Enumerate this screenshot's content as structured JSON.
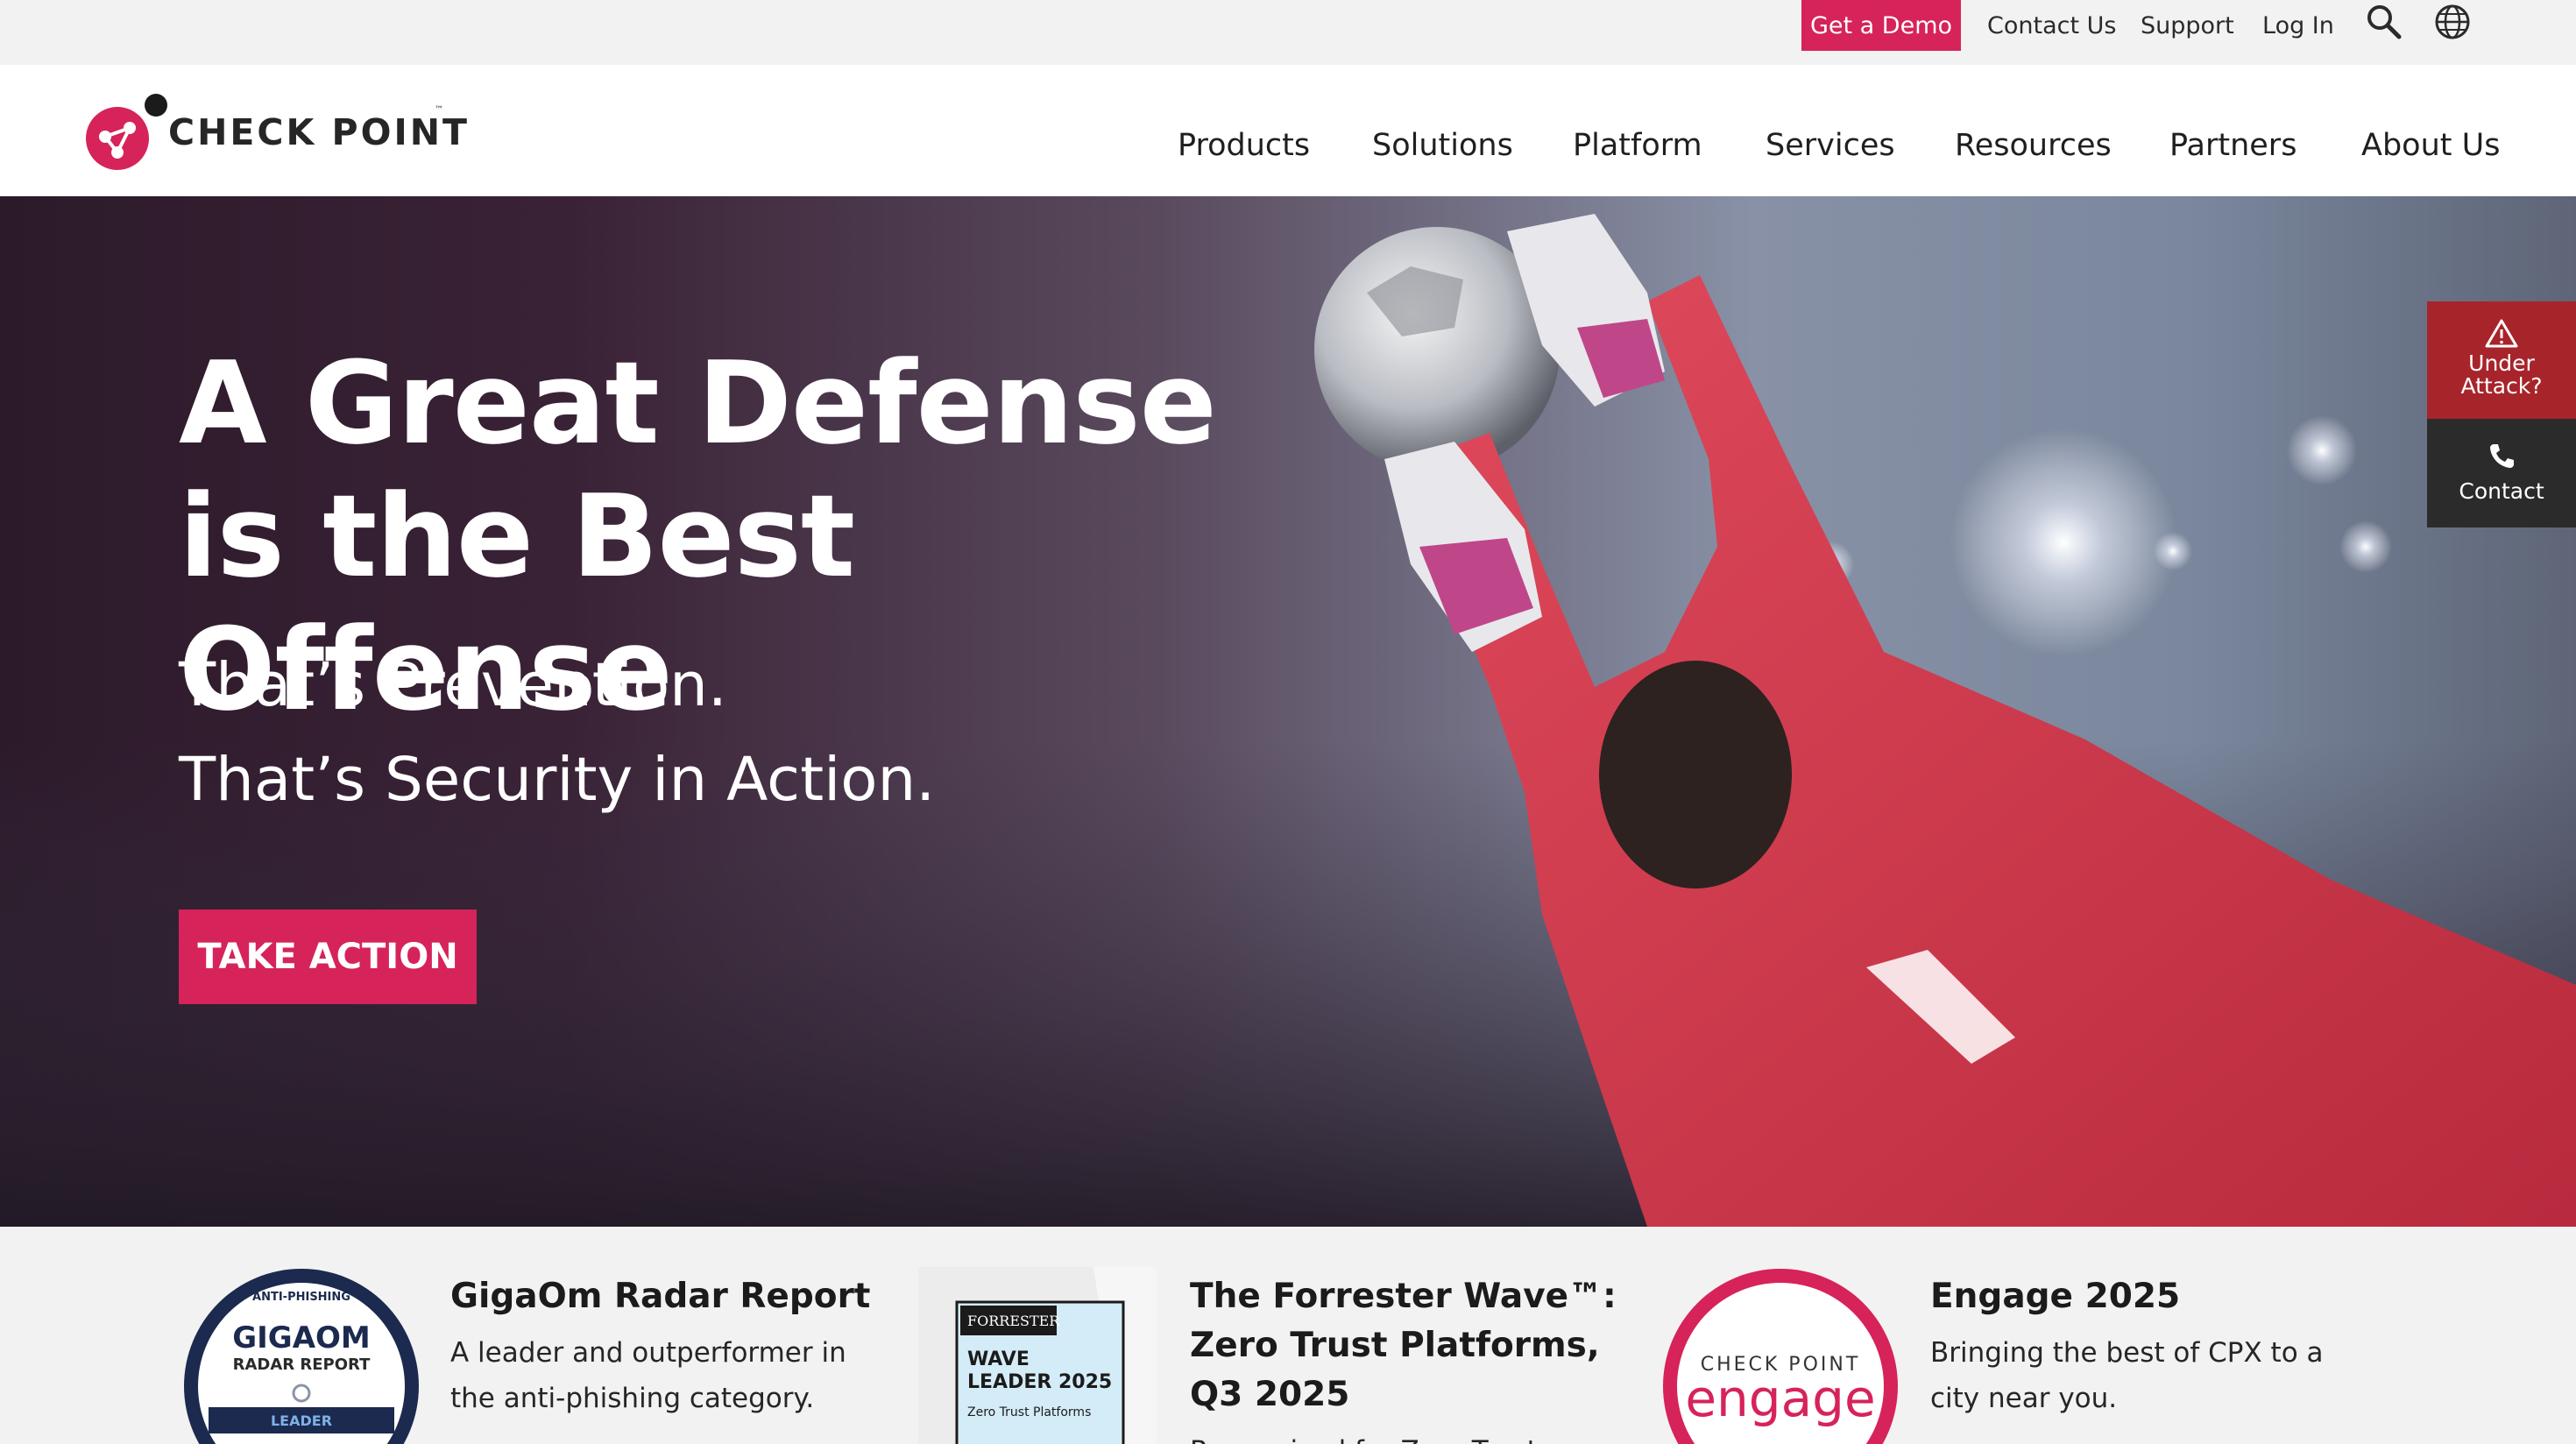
{
  "utility_bar": {
    "demo_label": "Get a Demo",
    "contact_label": "Contact Us",
    "support_label": "Support",
    "login_label": "Log In",
    "icons": [
      "search-icon",
      "globe-icon"
    ]
  },
  "header": {
    "logo_text": "CHECK POINT",
    "logo_tm": "™",
    "nav": [
      "Products",
      "Solutions",
      "Platform",
      "Services",
      "Resources",
      "Partners",
      "About Us"
    ]
  },
  "hero": {
    "title": "A Great Defense is the Best Offense",
    "subtitle_1": "That’s Prevention.",
    "subtitle_2": "That’s Security in Action.",
    "cta": "TAKE ACTION"
  },
  "side_widget": {
    "attack_label_1": "Under",
    "attack_label_2": "Attack?",
    "contact_label": "Contact",
    "icons": [
      "warning-icon",
      "phone-icon"
    ]
  },
  "promos": [
    {
      "title": "GigaOm Radar Report",
      "description": "A leader and outperformer in the anti-phishing category.",
      "badge_top": "ANTI-PHISHING",
      "badge_main": "GIGAOM",
      "badge_sub": "RADAR REPORT",
      "badge_ribbon": "LEADER"
    },
    {
      "title": "The Forrester Wave™: Zero Trust Platforms, Q3 2025",
      "description": "Recognized for Zero Trust",
      "badge_brand": "FORRESTER",
      "badge_line1": "WAVE",
      "badge_line2": "LEADER 2025",
      "badge_line3": "Zero Trust Platforms"
    },
    {
      "title": "Engage 2025",
      "description": "Bringing the best of CPX to a city near you.",
      "badge_top": "CHECK POINT",
      "badge_main": "engage"
    }
  ],
  "colors": {
    "brand": "#d6235a",
    "attack": "#a8242b",
    "dark": "#2b2b2b",
    "strip": "#f2f2f2"
  }
}
